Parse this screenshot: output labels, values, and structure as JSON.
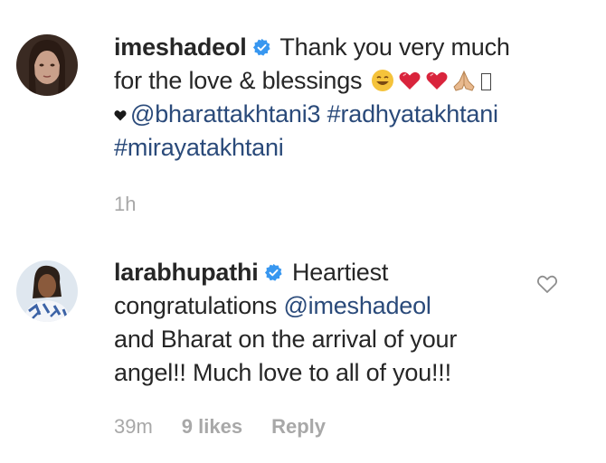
{
  "comments": [
    {
      "username": "imeshadeol",
      "verified": true,
      "text_line1": "Thank you very much",
      "text_line2": "for the love & blessings",
      "mention": "@bharattakhtani3",
      "hashtag1": "#radhyatakhtani",
      "hashtag2": "#mirayatakhtani",
      "timestamp": "1h",
      "emojis": [
        "grinning-face-icon",
        "red-heart-icon",
        "red-heart-icon",
        "folded-hands-icon",
        "missing-glyph-icon",
        "black-heart-icon"
      ]
    },
    {
      "username": "larabhupathi",
      "verified": true,
      "text_before": "Heartiest",
      "text_line2": "congratulations",
      "mention": "@imeshadeol",
      "text_after": "and Bharat on the arrival of your angel!! Much love to all of you!!!",
      "timestamp": "39m",
      "likes": "9 likes",
      "reply_label": "Reply"
    }
  ],
  "colors": {
    "text": "#262626",
    "link": "#2a4a7a",
    "meta": "#a8a8a8",
    "verified": "#3897f0",
    "heart": "#d9243c"
  }
}
